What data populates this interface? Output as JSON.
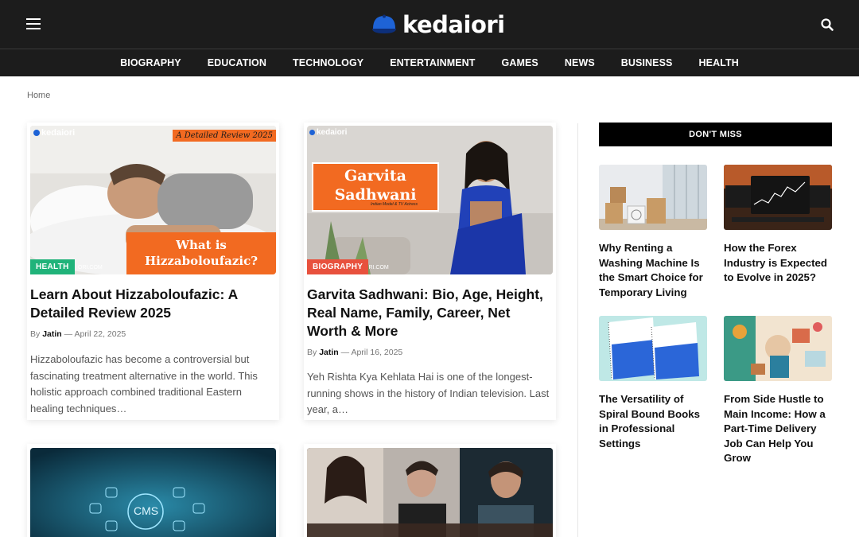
{
  "header": {
    "logo_text": "kedaiori",
    "menu_icon": "hamburger-menu-icon",
    "search_icon": "search-icon"
  },
  "nav": {
    "items": [
      {
        "label": "BIOGRAPHY"
      },
      {
        "label": "EDUCATION"
      },
      {
        "label": "TECHNOLOGY"
      },
      {
        "label": "ENTERTAINMENT"
      },
      {
        "label": "GAMES"
      },
      {
        "label": "NEWS"
      },
      {
        "label": "BUSINESS"
      },
      {
        "label": "HEALTH"
      }
    ]
  },
  "breadcrumb": "Home",
  "posts": [
    {
      "category": "HEALTH",
      "category_color": "#20b37a",
      "title": "Learn About Hizzaboloufazic: A Detailed Review 2025",
      "by": "By",
      "author": "Jatin",
      "date": "— April 22, 2025",
      "excerpt": "Hizzaboloufazic has become a controversial but fascinating treatment alternative in the world. This holistic approach combined traditional Eastern healing techniques…",
      "image": {
        "watermark": "kedaiori",
        "banner_top": "A Detailed Review 2025",
        "banner_main": "What is Hizzaboloufazic?",
        "site_url": "ORI.COM"
      }
    },
    {
      "category": "BIOGRAPHY",
      "category_color": "#e8513d",
      "title": "Garvita Sadhwani: Bio, Age, Height, Real Name, Family, Career, Net Worth & More",
      "by": "By",
      "author": "Jatin",
      "date": "— April 16, 2025",
      "excerpt": "Yeh Rishta Kya Kehlata Hai is one of the longest-running shows in the history of Indian television. Last year, a…",
      "image": {
        "watermark": "kedaiori",
        "name_box": "Garvita Sadhwani",
        "name_sub": "Indian Model & TV Actress",
        "site_url": "ORI.COM"
      }
    },
    {
      "image": {
        "label": "CMS"
      }
    },
    {
      "image": {}
    }
  ],
  "sidebar": {
    "heading": "DON'T MISS",
    "items": [
      {
        "title": "Why Renting a Washing Machine Is the Smart Choice for Temporary Living"
      },
      {
        "title": "How the Forex Industry is Expected to Evolve in 2025?"
      },
      {
        "title": "The Versatility of Spiral Bound Books in Professional Settings"
      },
      {
        "title": "From Side Hustle to Main Income: How a Part-Time Delivery Job Can Help You Grow"
      }
    ]
  },
  "colors": {
    "header_bg": "#1c1c1c",
    "accent_orange": "#f26a21",
    "health_badge": "#20b37a",
    "biography_badge": "#e8513d"
  }
}
